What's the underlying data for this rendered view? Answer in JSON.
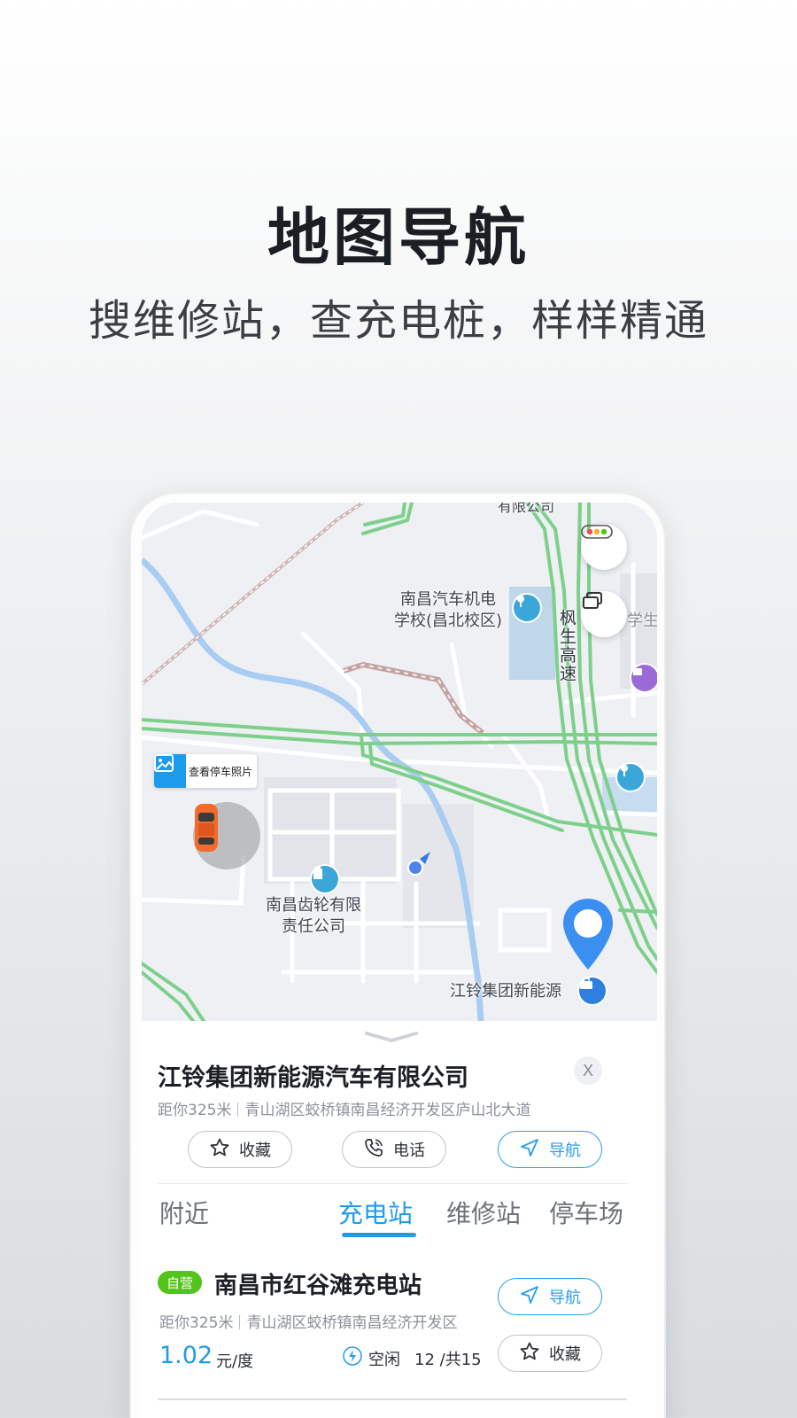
{
  "hero": {
    "title": "地图导航",
    "subtitle": "搜维修站，查充电桩，样样精通"
  },
  "map": {
    "labels": {
      "school": "南昌汽车机电\n学校(昌北校区)",
      "highway": "枫生高速",
      "gear_company": "南昌齿轮有限\n责任公司",
      "jiangling": "江铃集团新能源",
      "top_partial": "有限公司",
      "right_partial": "学生"
    },
    "view_parking_photo": "查看停车照片",
    "colors": {
      "road_green": "#7dd08a",
      "river": "#a9cdf2",
      "rail": "#c9a9a9",
      "pin": "#3a8ff0"
    }
  },
  "detail": {
    "company_name": "江铃集团新能源汽车有限公司",
    "close": "X",
    "distance": "距你325米",
    "address": "青山湖区蛟桥镇南昌经济开发区庐山北大道",
    "actions": {
      "favorite": "收藏",
      "phone": "电话",
      "navigate": "导航"
    }
  },
  "tabs": [
    {
      "label": "附近",
      "active": false
    },
    {
      "label": "充电站",
      "active": true
    },
    {
      "label": "维修站",
      "active": false
    },
    {
      "label": "停车场",
      "active": false
    }
  ],
  "station": {
    "badge": "自营",
    "name": "南昌市红谷滩充电站",
    "distance": "距你325米",
    "address": "青山湖区蛟桥镇南昌经济开发区",
    "price": "1.02",
    "price_unit": "元/度",
    "status": "空闲",
    "availability": "12 /共15",
    "navigate": "导航",
    "favorite": "收藏"
  },
  "theme": {
    "accent": "#1f9be8",
    "badge_green": "#52c41a"
  }
}
